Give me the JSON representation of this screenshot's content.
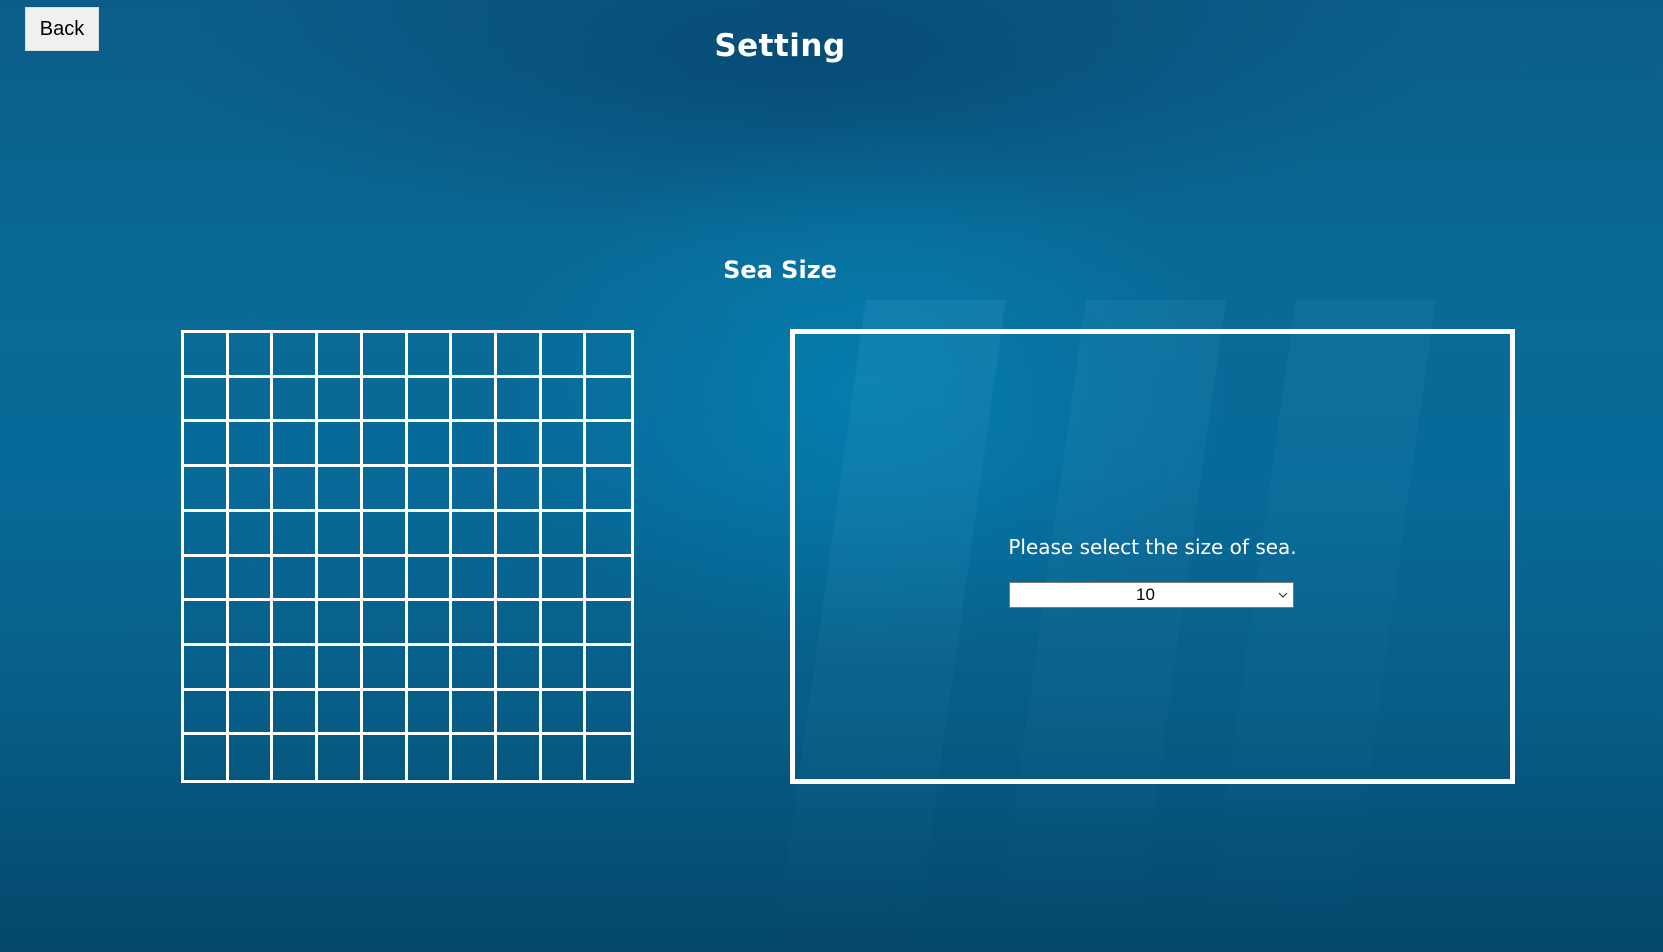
{
  "header": {
    "back_label": "Back",
    "title": "Setting"
  },
  "section": {
    "title": "Sea Size"
  },
  "grid": {
    "rows": 10,
    "cols": 10
  },
  "panel": {
    "prompt": "Please select the size of sea.",
    "size_select": {
      "selected": "10"
    }
  },
  "colors": {
    "line": "#ffffff",
    "sea": "#086a99"
  },
  "icons": {
    "dropdown": "chevron-down-icon"
  }
}
